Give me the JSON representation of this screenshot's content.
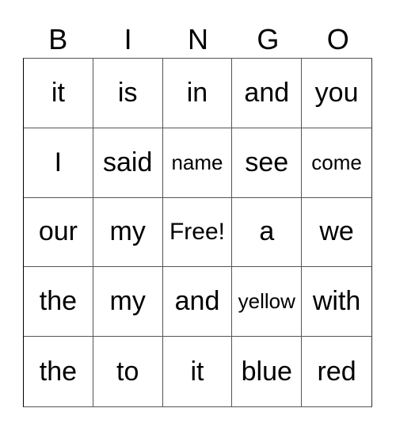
{
  "header": {
    "letters": [
      "B",
      "I",
      "N",
      "G",
      "O"
    ]
  },
  "grid": {
    "rows": [
      [
        "it",
        "is",
        "in",
        "and",
        "you"
      ],
      [
        "I",
        "said",
        "name",
        "see",
        "come"
      ],
      [
        "our",
        "my",
        "Free!",
        "a",
        "we"
      ],
      [
        "the",
        "my",
        "and",
        "yellow",
        "with"
      ],
      [
        "the",
        "to",
        "it",
        "blue",
        "red"
      ]
    ]
  }
}
